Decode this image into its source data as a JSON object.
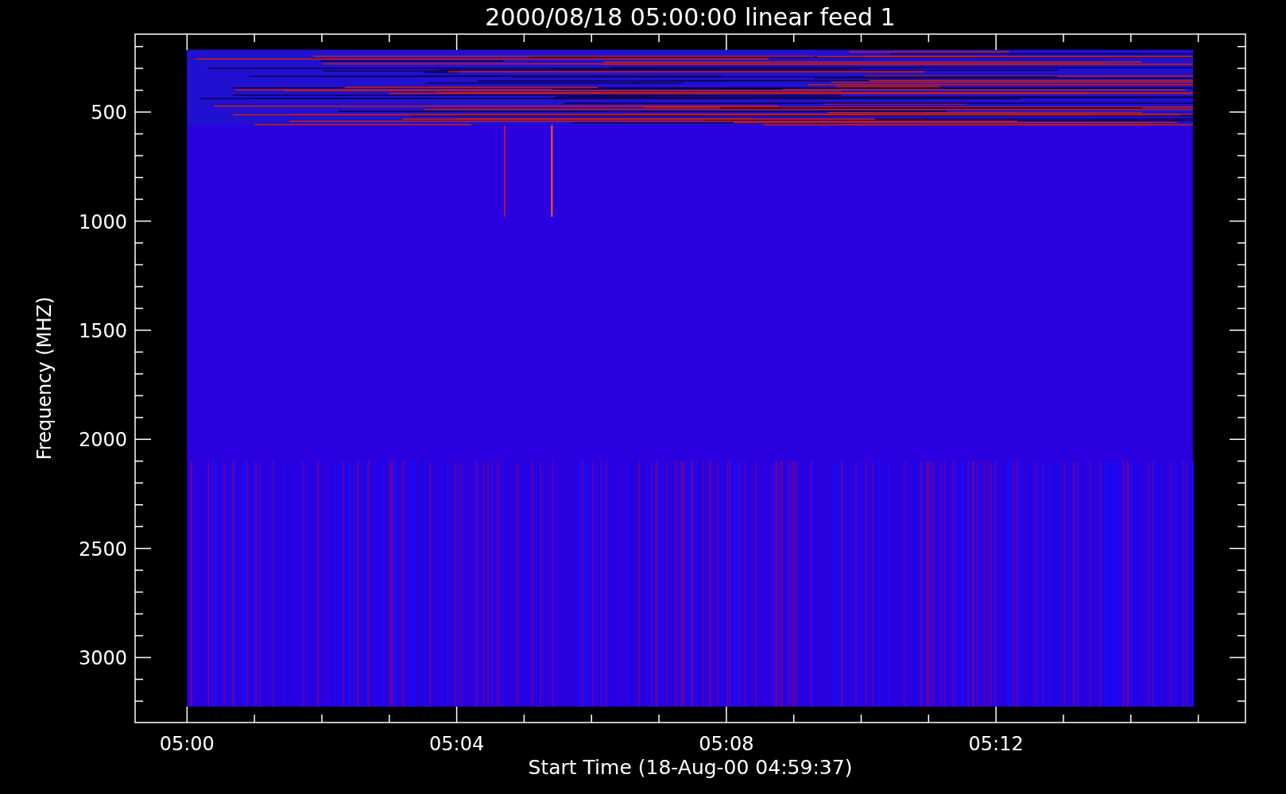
{
  "plot": {
    "title": "2000/08/18 05:00:00 linear feed 1",
    "y_axis": {
      "label": "Frequency (MHZ)",
      "ticks": [
        "500",
        "1000",
        "1500",
        "2000",
        "2500",
        "3000"
      ]
    },
    "x_axis": {
      "label": "Start Time (18-Aug-00 04:59:37)",
      "ticks": [
        "05:00",
        "05:04",
        "05:08",
        "05:12"
      ]
    }
  }
}
